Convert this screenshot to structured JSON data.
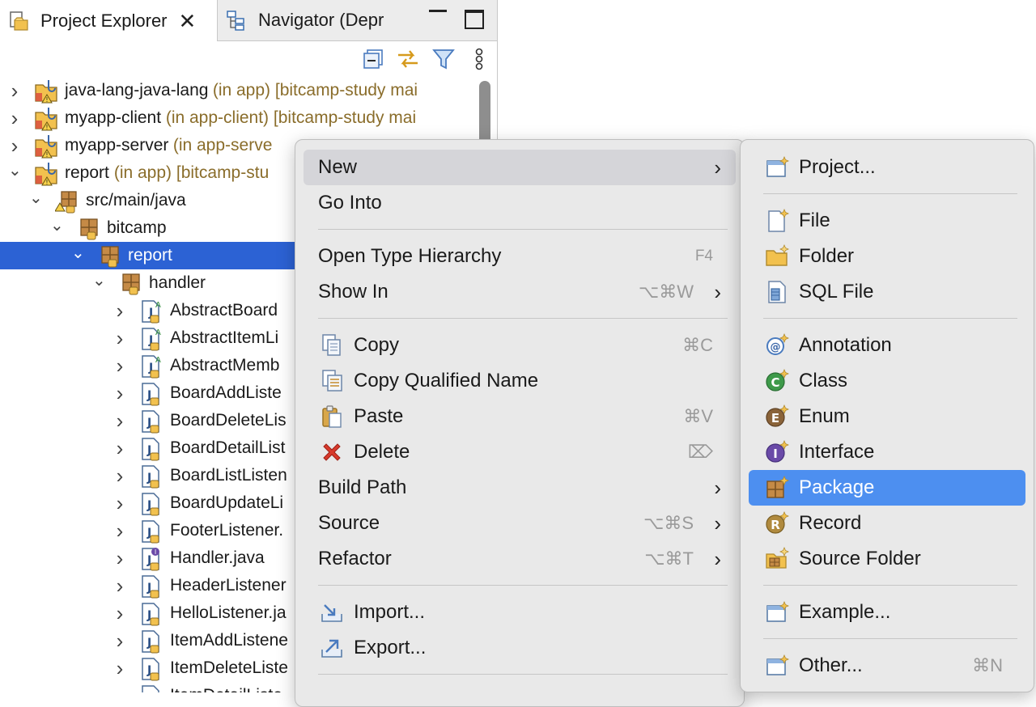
{
  "tabs": {
    "active_label": "Project Explorer",
    "inactive_label": "Navigator (Depr"
  },
  "toolbar": {
    "collapse_icon": "collapse-all-icon",
    "link_icon": "link-with-editor-icon",
    "filter_icon": "filter-icon",
    "menu_icon": "view-menu-icon"
  },
  "tree": [
    {
      "label": "java-lang-java-lang",
      "decoration": " (in app) [bitcamp-study mai",
      "expanded": false
    },
    {
      "label": "myapp-client",
      "decoration": " (in app-client) [bitcamp-study mai",
      "expanded": false
    },
    {
      "label": "myapp-server",
      "decoration": " (in app-serve",
      "expanded": false
    },
    {
      "label": "report",
      "decoration": " (in app) [bitcamp-stu",
      "expanded": true
    },
    {
      "label": "src/main/java",
      "decoration": "",
      "expanded": true
    },
    {
      "label": "bitcamp",
      "decoration": "",
      "expanded": true
    },
    {
      "label": "report",
      "decoration": "",
      "expanded": true,
      "selected": true
    },
    {
      "label": "handler",
      "decoration": "",
      "expanded": true
    },
    {
      "label": "AbstractBoard",
      "decoration": ""
    },
    {
      "label": "AbstractItemLi",
      "decoration": ""
    },
    {
      "label": "AbstractMemb",
      "decoration": ""
    },
    {
      "label": "BoardAddListe",
      "decoration": ""
    },
    {
      "label": "BoardDeleteLis",
      "decoration": ""
    },
    {
      "label": "BoardDetailList",
      "decoration": ""
    },
    {
      "label": "BoardListListen",
      "decoration": ""
    },
    {
      "label": "BoardUpdateLi",
      "decoration": ""
    },
    {
      "label": "FooterListener.",
      "decoration": ""
    },
    {
      "label": "Handler.java",
      "decoration": ""
    },
    {
      "label": "HeaderListener",
      "decoration": ""
    },
    {
      "label": "HelloListener.ja",
      "decoration": ""
    },
    {
      "label": "ItemAddListene",
      "decoration": ""
    },
    {
      "label": "ItemDeleteListe",
      "decoration": ""
    },
    {
      "label": "ItemDetailListe",
      "decoration": ""
    }
  ],
  "context_menu": {
    "new": "New",
    "go_into": "Go Into",
    "open_type_hierarchy": "Open Type Hierarchy",
    "open_type_hierarchy_shortcut": "F4",
    "show_in": "Show In",
    "show_in_shortcut": "⌥⌘W",
    "copy": "Copy",
    "copy_shortcut": "⌘C",
    "copy_qualified_name": "Copy Qualified Name",
    "paste": "Paste",
    "paste_shortcut": "⌘V",
    "delete": "Delete",
    "delete_shortcut": "⌦",
    "build_path": "Build Path",
    "source": "Source",
    "source_shortcut": "⌥⌘S",
    "refactor": "Refactor",
    "refactor_shortcut": "⌥⌘T",
    "import": "Import...",
    "export": "Export..."
  },
  "submenu": {
    "project": "Project...",
    "file": "File",
    "folder": "Folder",
    "sql_file": "SQL File",
    "annotation": "Annotation",
    "class": "Class",
    "enum": "Enum",
    "interface": "Interface",
    "package": "Package",
    "record": "Record",
    "source_folder": "Source Folder",
    "example": "Example...",
    "other": "Other...",
    "other_shortcut": "⌘N"
  },
  "colors": {
    "selection": "#2c62d4",
    "submenu_highlight": "#4d8ff0",
    "decoration_text": "#8a6d2b"
  }
}
